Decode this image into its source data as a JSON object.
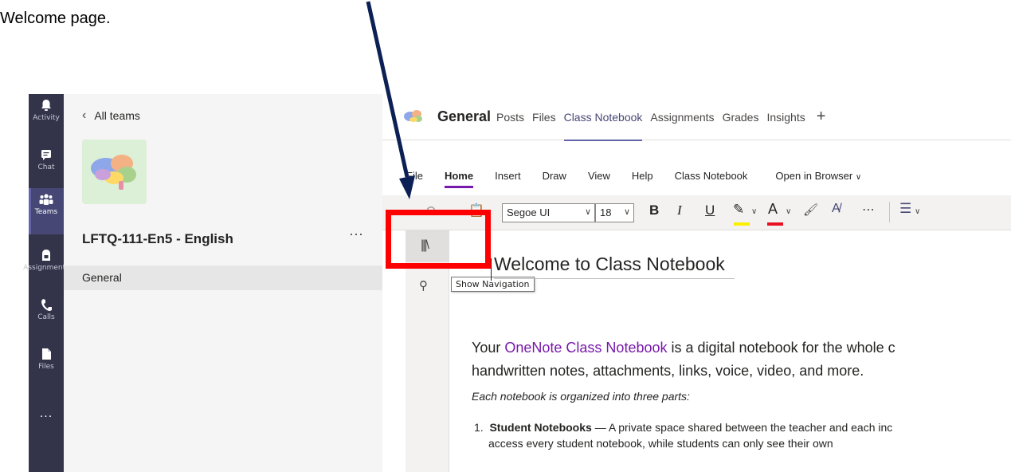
{
  "instruction": {
    "text": "Welcome page."
  },
  "rail": {
    "items": [
      {
        "label": "Activity",
        "icon": "bell-icon"
      },
      {
        "label": "Chat",
        "icon": "chat-icon"
      },
      {
        "label": "Teams",
        "icon": "teams-icon",
        "active": true
      },
      {
        "label": "Assignments",
        "icon": "assignments-icon"
      },
      {
        "label": "Calls",
        "icon": "phone-icon"
      },
      {
        "label": "Files",
        "icon": "file-icon"
      }
    ],
    "more": "..."
  },
  "panel": {
    "back_label": "All teams",
    "team_name": "LFTQ-111-En5 - English",
    "more": "···",
    "channel": "General"
  },
  "channel_header": {
    "title": "General",
    "tabs": [
      {
        "label": "Posts"
      },
      {
        "label": "Files"
      },
      {
        "label": "Class Notebook",
        "active": true
      },
      {
        "label": "Assignments"
      },
      {
        "label": "Grades"
      },
      {
        "label": "Insights"
      }
    ],
    "add": "+"
  },
  "ribbon": {
    "tabs": [
      {
        "label": "File"
      },
      {
        "label": "Home",
        "active": true
      },
      {
        "label": "Insert"
      },
      {
        "label": "Draw"
      },
      {
        "label": "View"
      },
      {
        "label": "Help"
      },
      {
        "label": "Class Notebook"
      }
    ],
    "open_in_browser": "Open in Browser",
    "font": "Segoe UI",
    "size": "18",
    "bold": "B",
    "italic": "I",
    "underline": "U",
    "font_color_letter": "A",
    "highlight_color": "#fcf000",
    "font_color": "#e81123"
  },
  "navigation": {
    "tooltip": "Show Navigation"
  },
  "page": {
    "title": "Welcome to Class Notebook",
    "para_line1_before": "Your ",
    "para_link": "OneNote Class Notebook",
    "para_line1_after": " is a digital notebook for the whole c",
    "para_line2": "handwritten notes, attachments, links, voice, video, and more.",
    "italic_line": "Each notebook is organized into three parts:",
    "list_number": "1.",
    "list_bold": "Student Notebooks",
    "list_rest": " — A private space shared between the teacher and each inc",
    "list_line2": "access every student notebook, while students can only see their own"
  },
  "colors": {
    "annotation_red": "#ff0000",
    "arrow_navy": "#0d2056",
    "accent": "#6264a7"
  }
}
